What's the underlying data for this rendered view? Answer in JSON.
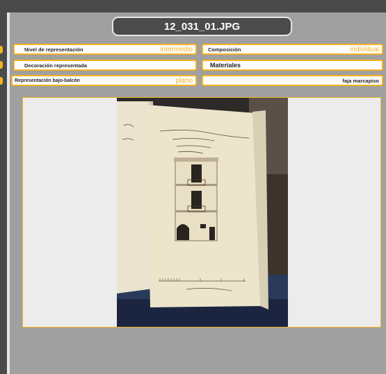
{
  "title": "12_031_01.JPG",
  "fields": {
    "nivel_label": "Nivel de representación",
    "nivel_value": "intermedio",
    "composicion_label": "Composición",
    "composicion_value": "individual",
    "decoracion_label": "Decoración representada",
    "materiales_label": "Materiales",
    "bajo_balcon_label": "Representación bajo-balcón",
    "bajo_balcon_value": "plano",
    "faja_value": "faja marcapiso"
  },
  "colors": {
    "accent": "#f3b320",
    "dark": "#4a4a4a",
    "background": "#a0a0a0"
  }
}
